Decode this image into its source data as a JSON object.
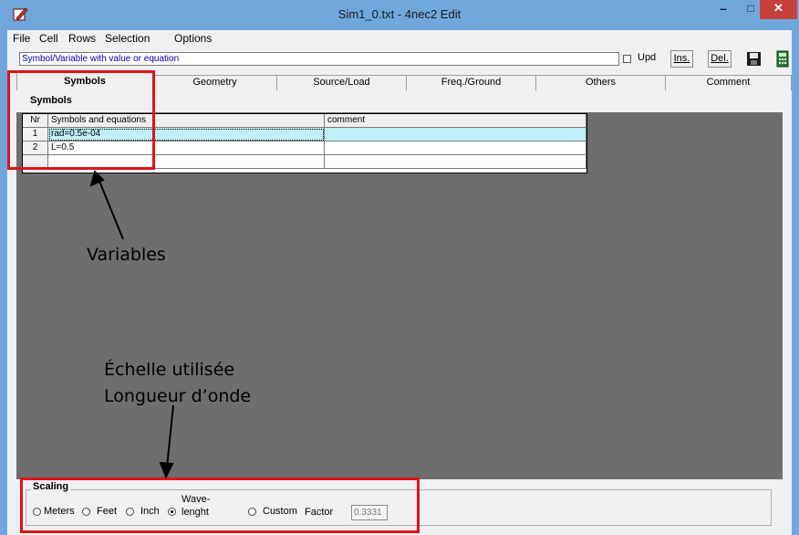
{
  "window": {
    "title": "Sim1_0.txt - 4nec2 Edit",
    "minimize": "–",
    "maximize": "□",
    "close": "✕"
  },
  "menu": [
    "File",
    "Cell",
    "Rows",
    "Selection",
    "Options"
  ],
  "hint": "Symbol/Variable with value or equation",
  "toolbar": {
    "upd_label": "Upd",
    "ins_label": "Ins.",
    "del_label": "Del."
  },
  "tabs": [
    "Symbols",
    "Geometry",
    "Source/Load",
    "Freq./Ground",
    "Others",
    "Comment"
  ],
  "panel_title": "Symbols",
  "grid": {
    "headers": [
      "Nr",
      "Symbols and equations",
      "comment"
    ],
    "rows": [
      {
        "nr": "1",
        "symbol": "rad=0.5e-04",
        "comment": ""
      },
      {
        "nr": "2",
        "symbol": "L=0.5",
        "comment": ""
      },
      {
        "nr": "",
        "symbol": "",
        "comment": ""
      }
    ]
  },
  "scaling": {
    "legend": "Scaling",
    "options": [
      "Meters",
      "Feet",
      "Inch",
      "Wave-",
      "lenght",
      "Custom"
    ],
    "selected": "Wave-lenght",
    "factor_label": "Factor",
    "factor_value": "0.3331"
  },
  "annotations": {
    "variables": "Variables",
    "scale_line1": "Échelle utilisée",
    "scale_line2": "Longueur d’onde"
  },
  "colors": {
    "annotation_box": "#e0131b",
    "selected_row": "#bfeff7",
    "title_bar": "#6fa7dc"
  }
}
